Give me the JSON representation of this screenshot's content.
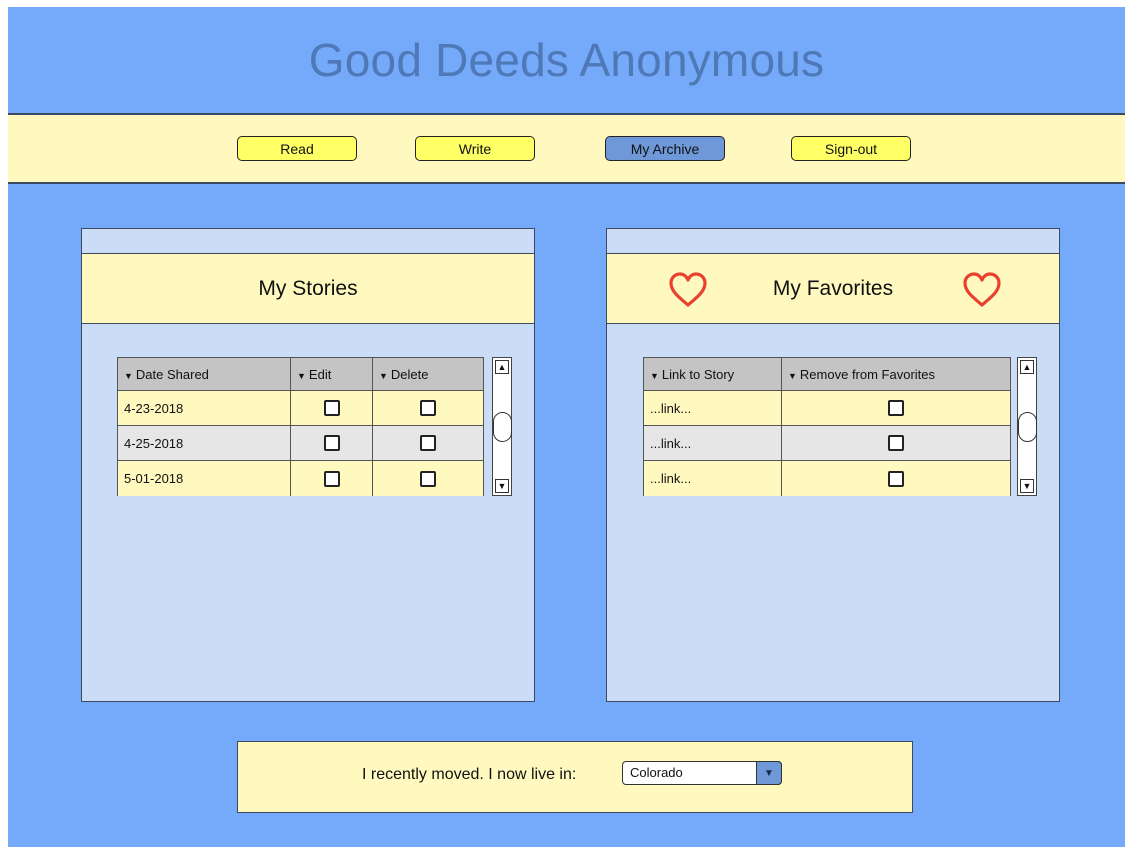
{
  "app": {
    "title": "Good Deeds Anonymous"
  },
  "nav": {
    "read": "Read",
    "write": "Write",
    "archive": "My Archive",
    "signout": "Sign-out"
  },
  "stories": {
    "title": "My Stories",
    "columns": [
      "Date Shared",
      "Edit",
      "Delete"
    ],
    "rows": [
      {
        "date": "4-23-2018"
      },
      {
        "date": "4-25-2018"
      },
      {
        "date": "5-01-2018"
      }
    ]
  },
  "favorites": {
    "title": "My Favorites",
    "columns": [
      "Link to Story",
      "Remove from Favorites"
    ],
    "rows": [
      {
        "link": "...link..."
      },
      {
        "link": "...link..."
      },
      {
        "link": "...link..."
      }
    ]
  },
  "move": {
    "label": "I recently moved. I now live in:",
    "selected": "Colorado"
  },
  "icons": {
    "caret": "caret-down-icon",
    "heart": "heart-icon",
    "scroll_up": "arrow-up-icon",
    "scroll_down": "arrow-down-icon",
    "dropdown": "chevron-down-icon"
  },
  "colors": {
    "page_bg": "#75a9f9",
    "bar_bg": "#fff9bf",
    "button_bg": "#ffff66",
    "active_button_bg": "#6e98d8",
    "panel_bg": "#cbdcf7",
    "heart": "#e8412f"
  }
}
